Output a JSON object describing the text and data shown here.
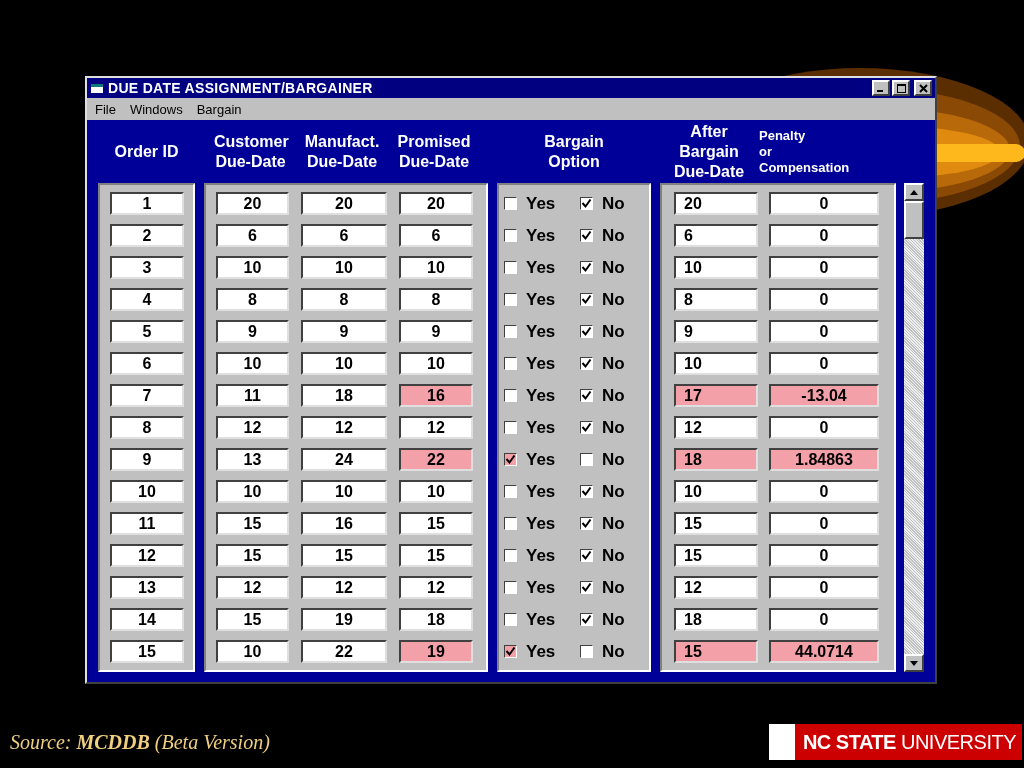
{
  "window": {
    "title": "DUE DATE ASSIGNMENT/BARGAINER",
    "menu": [
      "File",
      "Windows",
      "Bargain"
    ]
  },
  "columns": [
    "Order ID",
    "Customer\nDue-Date",
    "Manufact.\nDue-Date",
    "Promised\nDue-Date",
    "Bargain\nOption",
    "After\nBargain\nDue-Date",
    "Penalty\nor\nCompensation"
  ],
  "rows": [
    {
      "order": "1",
      "customer": "20",
      "manufact": "20",
      "promised": "20",
      "yes": {
        "label": "Yes",
        "checked": false
      },
      "no": {
        "label": "No",
        "checked": true
      },
      "after": "20",
      "penalty": "0",
      "flagged": false
    },
    {
      "order": "2",
      "customer": "6",
      "manufact": "6",
      "promised": "6",
      "yes": {
        "label": "Yes",
        "checked": false
      },
      "no": {
        "label": "No",
        "checked": true
      },
      "after": "6",
      "penalty": "0",
      "flagged": false
    },
    {
      "order": "3",
      "customer": "10",
      "manufact": "10",
      "promised": "10",
      "yes": {
        "label": "Yes",
        "checked": false
      },
      "no": {
        "label": "No",
        "checked": true
      },
      "after": "10",
      "penalty": "0",
      "flagged": false
    },
    {
      "order": "4",
      "customer": "8",
      "manufact": "8",
      "promised": "8",
      "yes": {
        "label": "Yes",
        "checked": false
      },
      "no": {
        "label": "No",
        "checked": true
      },
      "after": "8",
      "penalty": "0",
      "flagged": false
    },
    {
      "order": "5",
      "customer": "9",
      "manufact": "9",
      "promised": "9",
      "yes": {
        "label": "Yes",
        "checked": false
      },
      "no": {
        "label": "No",
        "checked": true
      },
      "after": "9",
      "penalty": "0",
      "flagged": false
    },
    {
      "order": "6",
      "customer": "10",
      "manufact": "10",
      "promised": "10",
      "yes": {
        "label": "Yes",
        "checked": false
      },
      "no": {
        "label": "No",
        "checked": true
      },
      "after": "10",
      "penalty": "0",
      "flagged": false
    },
    {
      "order": "7",
      "customer": "11",
      "manufact": "18",
      "promised": "16",
      "yes": {
        "label": "Yes",
        "checked": false
      },
      "no": {
        "label": "No",
        "checked": true
      },
      "after": "17",
      "penalty": "-13.04",
      "flagged": true
    },
    {
      "order": "8",
      "customer": "12",
      "manufact": "12",
      "promised": "12",
      "yes": {
        "label": "Yes",
        "checked": false
      },
      "no": {
        "label": "No",
        "checked": true
      },
      "after": "12",
      "penalty": "0",
      "flagged": false
    },
    {
      "order": "9",
      "customer": "13",
      "manufact": "24",
      "promised": "22",
      "yes": {
        "label": "Yes",
        "checked": true
      },
      "no": {
        "label": "No",
        "checked": false
      },
      "after": "18",
      "penalty": "1.84863",
      "flagged": true
    },
    {
      "order": "10",
      "customer": "10",
      "manufact": "10",
      "promised": "10",
      "yes": {
        "label": "Yes",
        "checked": false
      },
      "no": {
        "label": "No",
        "checked": true
      },
      "after": "10",
      "penalty": "0",
      "flagged": false
    },
    {
      "order": "11",
      "customer": "15",
      "manufact": "16",
      "promised": "15",
      "yes": {
        "label": "Yes",
        "checked": false
      },
      "no": {
        "label": "No",
        "checked": true
      },
      "after": "15",
      "penalty": "0",
      "flagged": false
    },
    {
      "order": "12",
      "customer": "15",
      "manufact": "15",
      "promised": "15",
      "yes": {
        "label": "Yes",
        "checked": false
      },
      "no": {
        "label": "No",
        "checked": true
      },
      "after": "15",
      "penalty": "0",
      "flagged": false
    },
    {
      "order": "13",
      "customer": "12",
      "manufact": "12",
      "promised": "12",
      "yes": {
        "label": "Yes",
        "checked": false
      },
      "no": {
        "label": "No",
        "checked": true
      },
      "after": "12",
      "penalty": "0",
      "flagged": false
    },
    {
      "order": "14",
      "customer": "15",
      "manufact": "19",
      "promised": "18",
      "yes": {
        "label": "Yes",
        "checked": false
      },
      "no": {
        "label": "No",
        "checked": true
      },
      "after": "18",
      "penalty": "0",
      "flagged": false
    },
    {
      "order": "15",
      "customer": "10",
      "manufact": "22",
      "promised": "19",
      "yes": {
        "label": "Yes",
        "checked": true
      },
      "no": {
        "label": "No",
        "checked": false
      },
      "after": "15",
      "penalty": "44.0714",
      "flagged": true
    }
  ],
  "source": "Source: **MCDDB** (Beta Version)",
  "logo": "**NC STATE** UNIVERSITY"
}
